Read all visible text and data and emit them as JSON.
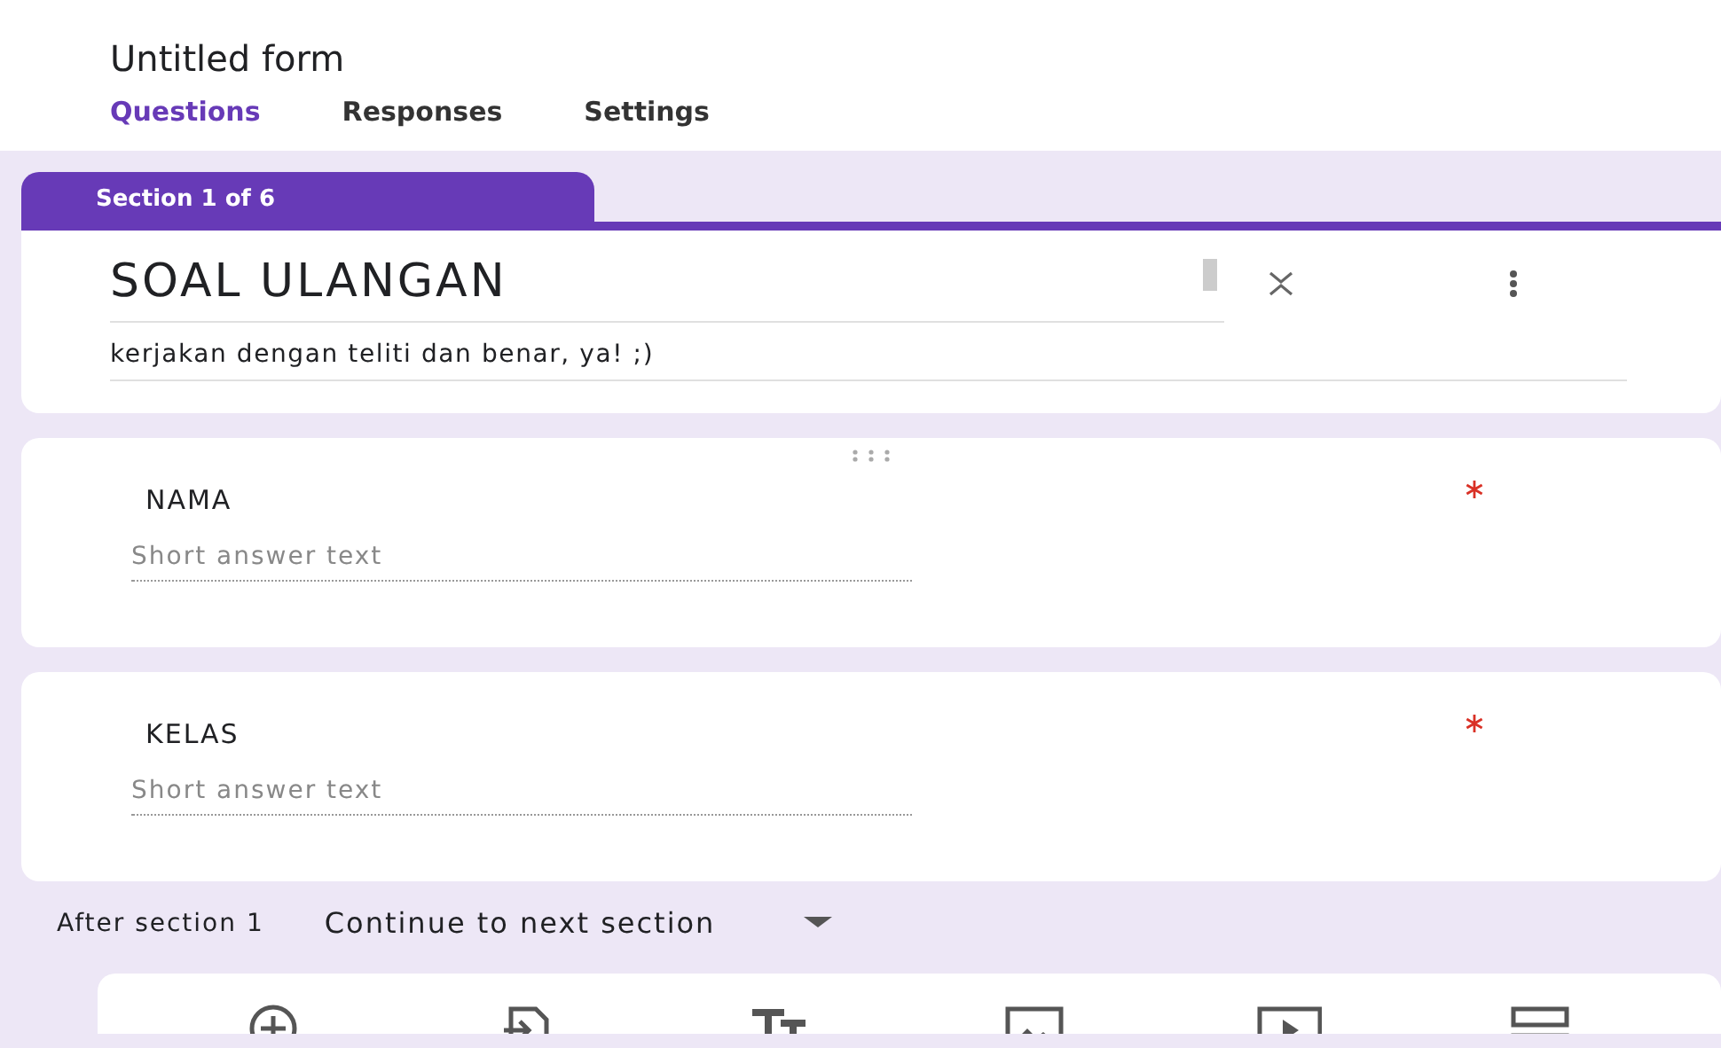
{
  "form_title": "Untitled form",
  "tabs": [
    {
      "label": "Questions",
      "selected": true
    },
    {
      "label": "Responses",
      "selected": false
    },
    {
      "label": "Settings",
      "selected": false
    }
  ],
  "section_label": "Section 1 of 6",
  "header": {
    "title": "SOAL ULANGAN",
    "description": "kerjakan dengan teliti dan benar, ya! ;)"
  },
  "questions": [
    {
      "title": "NAMA",
      "placeholder": "Short answer text",
      "required": true,
      "drag_handle": true
    },
    {
      "title": "KELAS",
      "placeholder": "Short answer text",
      "required": true,
      "drag_handle": false
    }
  ],
  "after_section": {
    "label": "After section 1",
    "value": "Continue to next section"
  },
  "toolbar": [
    {
      "kind": "add"
    },
    {
      "kind": "import"
    },
    {
      "kind": "text"
    },
    {
      "kind": "image"
    },
    {
      "kind": "video"
    },
    {
      "kind": "section"
    }
  ]
}
